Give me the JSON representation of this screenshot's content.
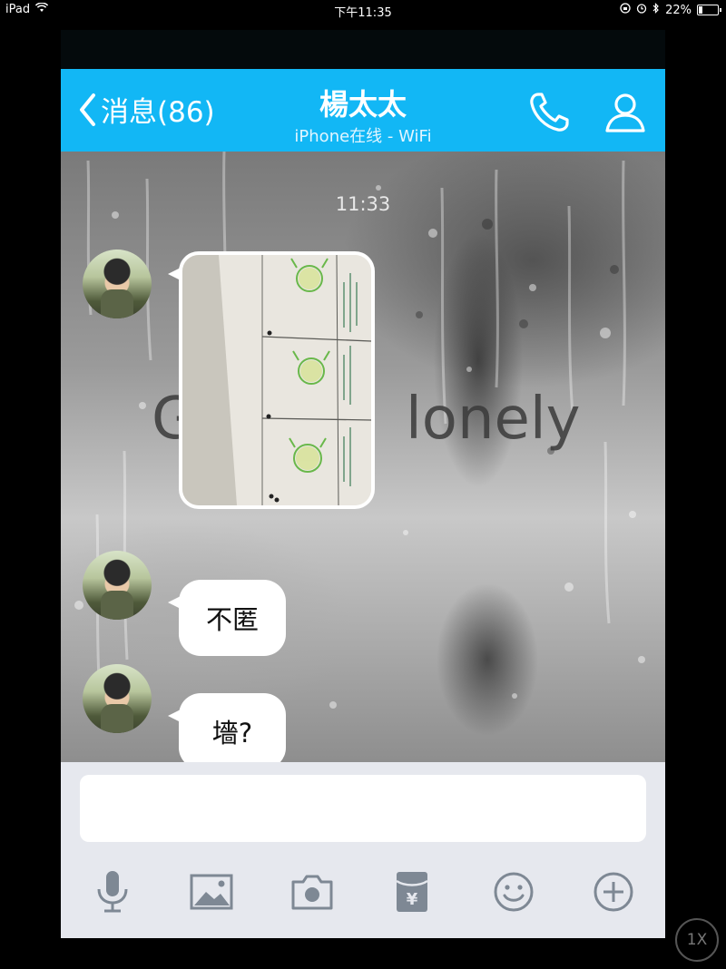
{
  "status_bar": {
    "device": "iPad",
    "time": "下午11:35",
    "battery": "22%",
    "battery_level": 0.22,
    "icons": [
      "wifi-icon",
      "orientation-lock-icon",
      "alarm-icon",
      "bluetooth-icon",
      "battery-icon"
    ]
  },
  "nav": {
    "back_label": "消息(86)",
    "title": "楊太太",
    "subtitle": "iPhone在线 - WiFi",
    "icons": [
      "chevron-left-icon",
      "phone-icon",
      "user-icon"
    ]
  },
  "chat": {
    "timestamp": "11:33",
    "background_text_left": "G",
    "background_text_right": "lonely",
    "messages": [
      {
        "type": "image",
        "description_icon": "photo-attachment"
      },
      {
        "type": "text",
        "text": "不匿"
      },
      {
        "type": "text",
        "text": "墻?"
      }
    ]
  },
  "input": {
    "placeholder": "",
    "tools": [
      "microphone-icon",
      "image-icon",
      "camera-icon",
      "red-packet-icon",
      "emoji-icon",
      "plus-icon"
    ]
  },
  "overlay": {
    "zoom_label": "1X"
  },
  "colors": {
    "accent": "#12b7f5",
    "input_bg": "#e6e8ee"
  }
}
